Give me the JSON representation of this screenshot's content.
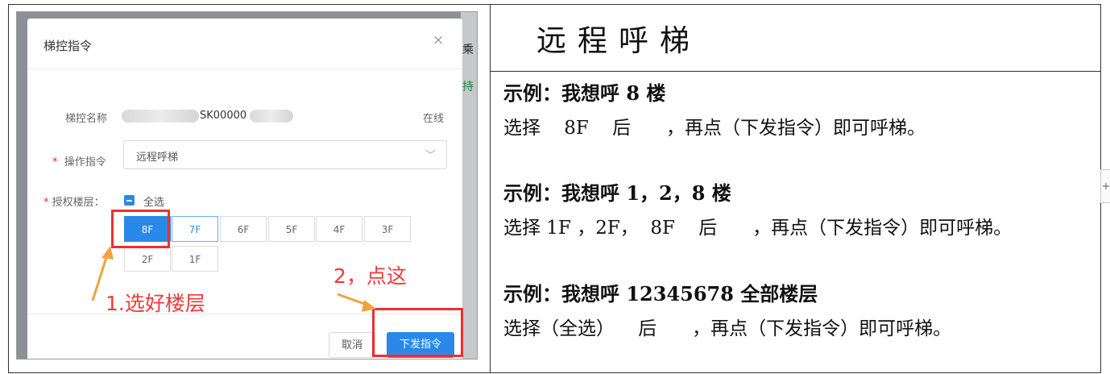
{
  "dialog": {
    "title": "梯控指令",
    "close_glyph": "×",
    "bg_text_1": "乘",
    "bg_text_2": "持",
    "controller_label": "梯控名称",
    "controller_value": "SK00000",
    "controller_status": "在线",
    "operation_label": "操作指令",
    "operation_value": "远程呼梯",
    "floors_label": "授权楼层：",
    "select_all_label": "全选",
    "required_mark": "*",
    "floors": [
      "8F",
      "7F",
      "6F",
      "5F",
      "4F",
      "3F",
      "2F",
      "1F"
    ],
    "selected_floor": "8F",
    "cancel_label": "取消",
    "submit_label": "下发指令"
  },
  "annotations": {
    "step1": "1.选好楼层",
    "step2": "2，点这",
    "color": "#ee3b3b"
  },
  "instructions": {
    "title": "远程呼梯",
    "examples": [
      {
        "heading": "示例：我想呼 8 楼",
        "text": "选择    8F    后      ，再点（下发指令）即可呼梯。"
      },
      {
        "heading": "示例：我想呼 1，2，8 楼",
        "text": "选择 1F ，2F，  8F    后      ，再点（下发指令）即可呼梯。"
      },
      {
        "heading": "示例：我想呼 12345678 全部楼层",
        "text": "选择（全选）    后      ，再点（下发指令）即可呼梯。"
      }
    ]
  },
  "edge_button": "+",
  "colors": {
    "primary": "#2a88e9",
    "annotation_red": "#ec2f2f"
  }
}
